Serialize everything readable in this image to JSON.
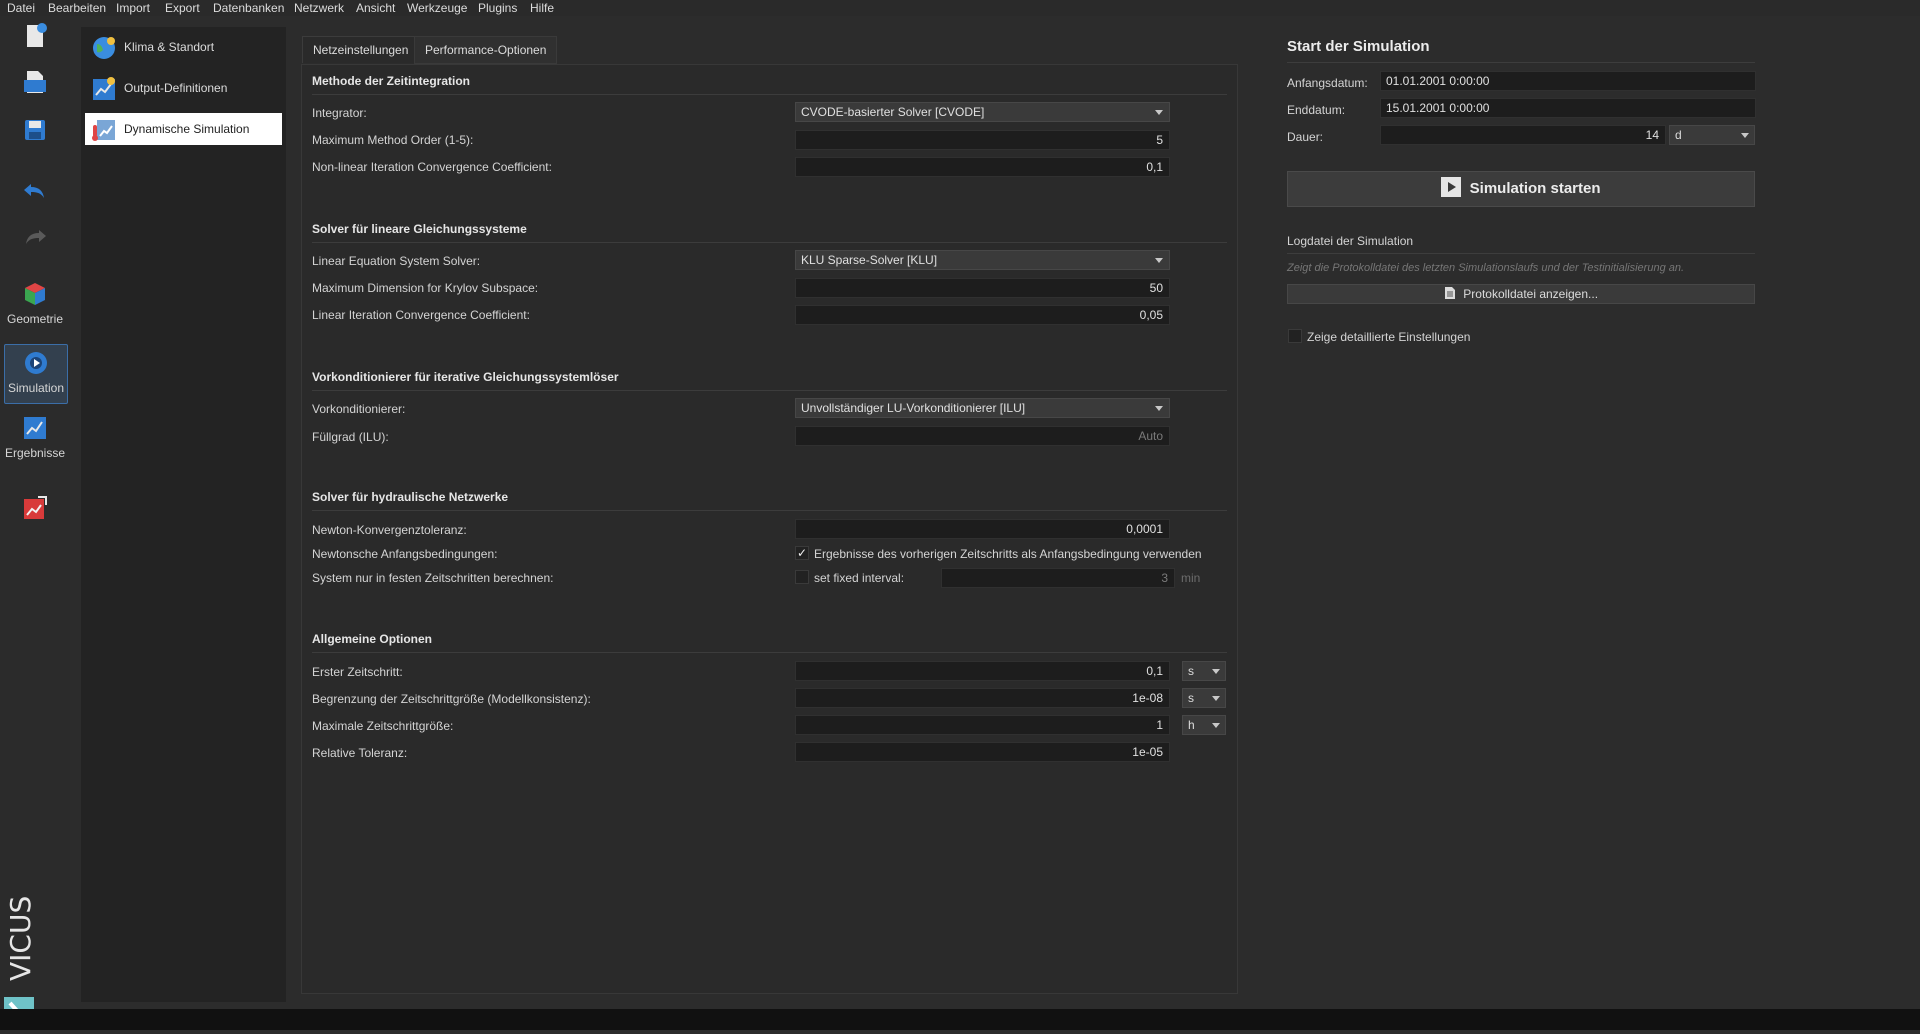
{
  "menu": [
    "Datei",
    "Bearbeiten",
    "Import",
    "Export",
    "Datenbanken",
    "Netzwerk",
    "Ansicht",
    "Werkzeuge",
    "Plugins",
    "Hilfe"
  ],
  "toolbar": {
    "geometry": "Geometrie",
    "simulation": "Simulation",
    "results": "Ergebnisse",
    "brand": "VICUS"
  },
  "subnav": {
    "items": [
      "Klima & Standort",
      "Output-Definitionen",
      "Dynamische Simulation"
    ],
    "selected": "Dynamische Simulation"
  },
  "tabs": [
    "Netzeinstellungen",
    "Performance-Optionen"
  ],
  "sections": {
    "time_integration": {
      "title": "Methode der Zeitintegration",
      "integrator_label": "Integrator:",
      "integrator_value": "CVODE-basierter Solver [CVODE]",
      "max_order_label": "Maximum Method Order (1-5):",
      "max_order_value": "5",
      "nonlinear_label": "Non-linear Iteration Convergence Coefficient:",
      "nonlinear_value": "0,1"
    },
    "linear_solver": {
      "title": "Solver für lineare Gleichungssysteme",
      "solver_label": "Linear Equation System Solver:",
      "solver_value": "KLU Sparse-Solver [KLU]",
      "krylov_label": "Maximum Dimension for Krylov Subspace:",
      "krylov_value": "50",
      "lin_conv_label": "Linear Iteration Convergence Coefficient:",
      "lin_conv_value": "0,05"
    },
    "preconditioner": {
      "title": "Vorkonditionierer für iterative Gleichungssystemlöser",
      "precond_label": "Vorkonditionierer:",
      "precond_value": "Unvollständiger LU-Vorkonditionierer [ILU]",
      "fill_label": "Füllgrad (ILU):",
      "fill_value": "Auto"
    },
    "hydraulic": {
      "title": "Solver für hydraulische Netzwerke",
      "newton_tol_label": "Newton-Konvergenztoleranz:",
      "newton_tol_value": "0,0001",
      "newton_init_label": "Newtonsche Anfangsbedingungen:",
      "newton_init_check": "Ergebnisse des vorherigen Zeitschritts als Anfangsbedingung verwenden",
      "newton_init_checked": true,
      "fixed_label": "System nur in festen Zeitschritten berechnen:",
      "fixed_check": "set fixed interval:",
      "fixed_checked": false,
      "fixed_value": "3",
      "fixed_unit": "min"
    },
    "general": {
      "title": "Allgemeine Optionen",
      "first_step_label": "Erster Zeitschritt:",
      "first_step_value": "0,1",
      "first_step_unit": "s",
      "limit_label": "Begrenzung der Zeitschrittgröße (Modellkonsistenz):",
      "limit_value": "1e-08",
      "limit_unit": "s",
      "max_step_label": "Maximale Zeitschrittgröße:",
      "max_step_value": "1",
      "max_step_unit": "h",
      "rel_tol_label": "Relative Toleranz:",
      "rel_tol_value": "1e-05"
    }
  },
  "simulation": {
    "title": "Start der Simulation",
    "start_label": "Anfangsdatum:",
    "start_value": "01.01.2001  0:00:00",
    "end_label": "Enddatum:",
    "end_value": "15.01.2001  0:00:00",
    "duration_label": "Dauer:",
    "duration_value": "14",
    "duration_unit": "d",
    "start_button": "Simulation starten",
    "log_title": "Logdatei der Simulation",
    "log_hint": "Zeigt die Protokolldatei des letzten Simulationslaufs und der Testinitialisierung an.",
    "log_button": "Protokolldatei anzeigen...",
    "details_label": "Zeige detaillierte Einstellungen",
    "details_checked": false
  },
  "colors": {
    "background": "#2c2c2c",
    "field": "#1d1d1d",
    "accent": "#3b6ea8"
  }
}
